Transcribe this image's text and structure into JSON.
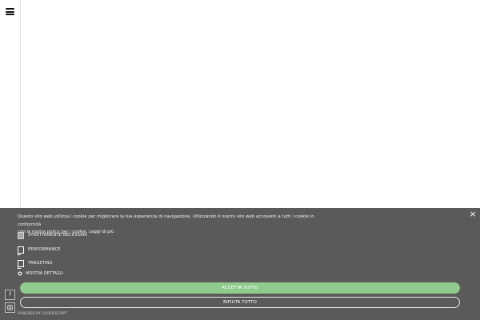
{
  "cookie_banner": {
    "text_line1": "Questo sito web utilizza i cookie per migliorare la tua esperienza di navigazione. Utilizzando il nostro sito web accosenti a tutti i cookie in conformità",
    "text_line2": "con la nostra policy per i cookie.",
    "read_more": "Leggi di più",
    "close_symbol": "×",
    "options": [
      {
        "label": "STRETTAMENTE NECESSARI",
        "checked": true
      },
      {
        "label": "PERFORMANCE",
        "checked": false
      },
      {
        "label": "TARGETING",
        "checked": false
      }
    ],
    "show_details": "MOSTRA DETTAGLI",
    "accept_all": "ACCETTA TUTTO",
    "reject_all": "RIFIUTA TUTTO",
    "powered_by": "POWERED BY COOKIESCRIPT"
  },
  "social": {
    "facebook_glyph": "f"
  },
  "colors": {
    "banner_bg": "#5a5a5a",
    "accept_bg": "#8fcb8c",
    "page_bg": "#ffffff"
  },
  "icons": [
    "hamburger-menu-icon",
    "close-icon",
    "gear-icon",
    "facebook-icon",
    "instagram-icon"
  ]
}
